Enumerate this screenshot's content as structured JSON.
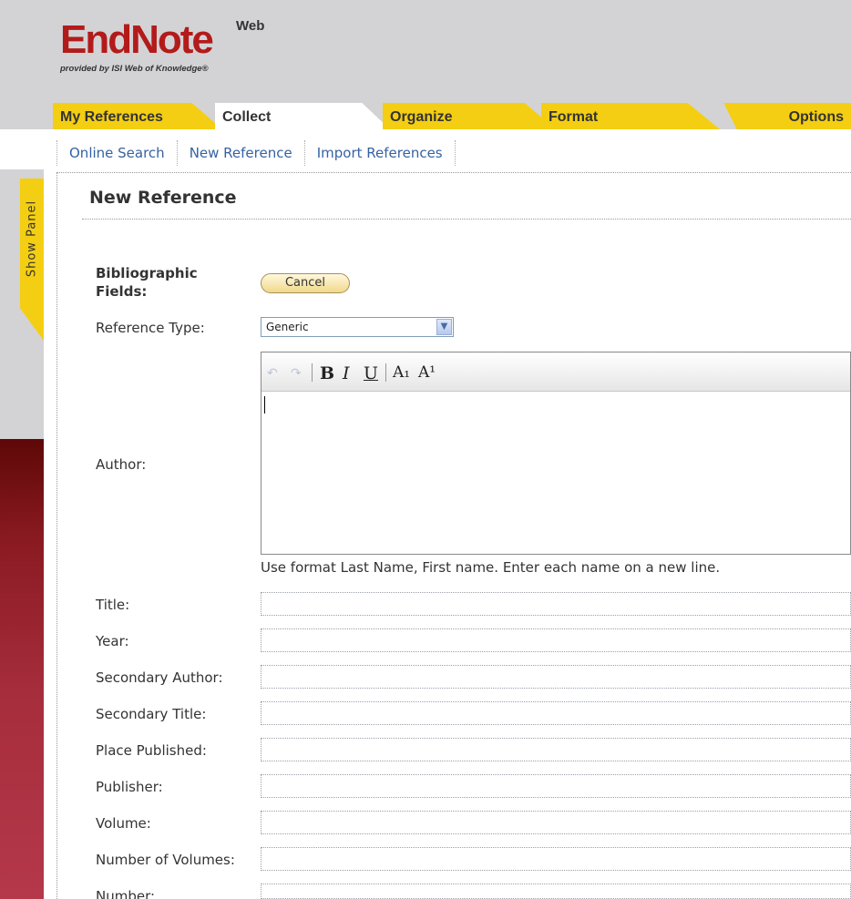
{
  "logo": {
    "word": "EndNote",
    "superscript": "Web",
    "tagline": "provided by ISI Web of Knowledge®"
  },
  "tabs": [
    {
      "label": "My References"
    },
    {
      "label": "Collect"
    },
    {
      "label": "Organize"
    },
    {
      "label": "Format"
    },
    {
      "label": "Options"
    }
  ],
  "subnav": [
    {
      "label": "Online Search"
    },
    {
      "label": "New Reference"
    },
    {
      "label": "Import References"
    }
  ],
  "side_panel": {
    "label": "Show Panel"
  },
  "page_title": "New Reference",
  "form": {
    "section_label": "Bibliographic Fields:",
    "cancel_label": "Cancel",
    "reference_type_label": "Reference Type:",
    "reference_type_value": "Generic",
    "author_label": "Author:",
    "author_hint": "Use format Last Name, First name. Enter each name on a new line.",
    "toolbar": {
      "bold": "B",
      "italic": "I",
      "underline": "U",
      "subscript": "A₁",
      "superscript": "A¹"
    },
    "fields": [
      {
        "label": "Title:",
        "value": ""
      },
      {
        "label": "Year:",
        "value": ""
      },
      {
        "label": "Secondary Author:",
        "value": ""
      },
      {
        "label": "Secondary Title:",
        "value": ""
      },
      {
        "label": "Place Published:",
        "value": ""
      },
      {
        "label": "Publisher:",
        "value": ""
      },
      {
        "label": "Volume:",
        "value": ""
      },
      {
        "label": "Number of Volumes:",
        "value": ""
      },
      {
        "label": "Number:",
        "value": ""
      }
    ]
  },
  "colors": {
    "tab_yellow": "#f4ce12",
    "logo_red": "#b31b1b",
    "link_blue": "#3562a3",
    "header_gray": "#d3d3d5"
  }
}
